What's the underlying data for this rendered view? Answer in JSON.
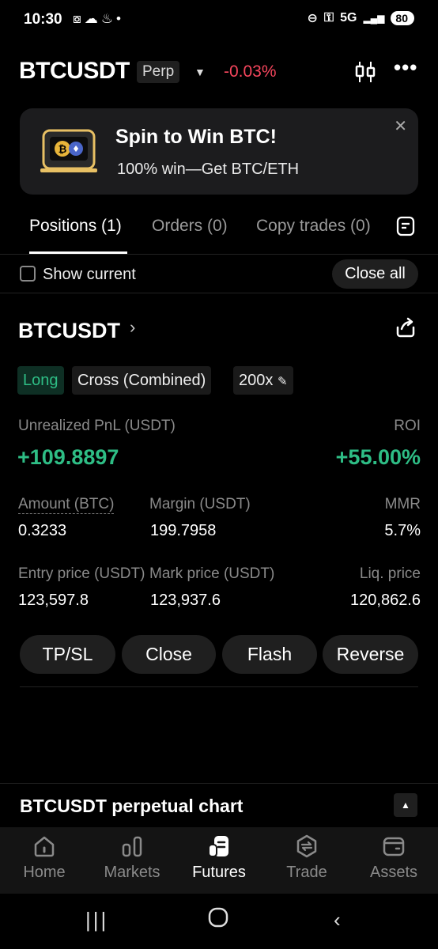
{
  "status_bar": {
    "time": "10:30",
    "network": "5G",
    "battery": "80"
  },
  "header": {
    "symbol": "BTCUSDT",
    "contract_type": "Perp",
    "change": "-0.03%"
  },
  "banner": {
    "title": "Spin to Win BTC!",
    "subtitle": "100% win—Get BTC/ETH"
  },
  "tabs": [
    {
      "label": "Positions (1)",
      "active": true
    },
    {
      "label": "Orders (0)",
      "active": false
    },
    {
      "label": "Copy trades (0)",
      "active": false
    }
  ],
  "filter": {
    "show_current_label": "Show current",
    "show_current_checked": false,
    "close_all_label": "Close all"
  },
  "position": {
    "symbol": "BTCUSDT",
    "side": "Long",
    "margin_mode": "Cross (Combined)",
    "leverage": "200x",
    "pnl_label": "Unrealized PnL (USDT)",
    "pnl_value": "+109.8897",
    "roi_label": "ROI",
    "roi_value": "+55.00%",
    "amount_label": "Amount (BTC)",
    "amount_value": "0.3233",
    "margin_label": "Margin (USDT)",
    "margin_value": "199.7958",
    "mmr_label": "MMR",
    "mmr_value": "5.7%",
    "entry_label": "Entry price (USDT)",
    "entry_value": "123,597.8",
    "mark_label": "Mark price (USDT)",
    "mark_value": "123,937.6",
    "liq_label": "Liq. price",
    "liq_value": "120,862.6",
    "buttons": {
      "tpsl": "TP/SL",
      "close": "Close",
      "flash": "Flash",
      "reverse": "Reverse"
    }
  },
  "chart_section": {
    "title": "BTCUSDT perpetual chart"
  },
  "bottom_nav": [
    {
      "label": "Home",
      "icon": "home-icon",
      "active": false
    },
    {
      "label": "Markets",
      "icon": "markets-icon",
      "active": false
    },
    {
      "label": "Futures",
      "icon": "futures-icon",
      "active": true
    },
    {
      "label": "Trade",
      "icon": "trade-icon",
      "active": false
    },
    {
      "label": "Assets",
      "icon": "wallet-icon",
      "active": false
    }
  ],
  "colors": {
    "positive": "#2ebd85",
    "negative": "#f6465d",
    "background": "#000000",
    "surface": "#1f1f1f"
  }
}
